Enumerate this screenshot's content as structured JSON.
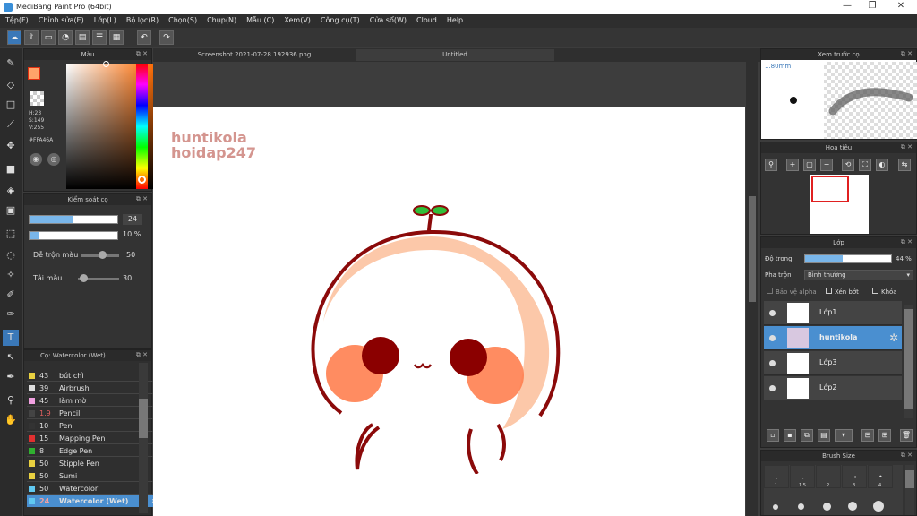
{
  "window": {
    "title": "MediBang Paint Pro (64bit)",
    "min": "—",
    "max": "❐",
    "close": "✕"
  },
  "menu": [
    "Tệp(F)",
    "Chỉnh sửa(E)",
    "Lớp(L)",
    "Bộ lọc(R)",
    "Chọn(S)",
    "Chụp(N)",
    "Mẫu (C)",
    "Xem(V)",
    "Công cụ(T)",
    "Cửa sổ(W)",
    "Cloud",
    "Help"
  ],
  "color_panel": {
    "title": "Màu",
    "h": "H:23",
    "s": "S:149",
    "v": "V:255",
    "hex": "#FFA46A",
    "fg": "#FFA46A"
  },
  "brush_control": {
    "title": "Kiểm soát cọ",
    "size_value": "24",
    "opacity_value": "10 %",
    "blend_label": "Dễ trộn màu",
    "blend_value": "50",
    "flow_label": "Tải màu",
    "flow_value": "30"
  },
  "brush_panel": {
    "title": "Cọ: Watercolor (Wet)",
    "items": [
      {
        "size": "43",
        "name": "bút chì",
        "color": "#e8d040"
      },
      {
        "size": "39",
        "name": "Airbrush",
        "color": "#dddddd"
      },
      {
        "size": "45",
        "name": "làm mờ",
        "color": "#f0a0e0"
      },
      {
        "size": "1.9",
        "name": "Pencil",
        "color": "#444444"
      },
      {
        "size": "10",
        "name": "Pen",
        "color": "#333333"
      },
      {
        "size": "15",
        "name": "Mapping Pen",
        "color": "#e03030"
      },
      {
        "size": "8",
        "name": "Edge Pen",
        "color": "#30b030"
      },
      {
        "size": "50",
        "name": "Stipple Pen",
        "color": "#e8d040"
      },
      {
        "size": "50",
        "name": "Sumi",
        "color": "#e8d040"
      },
      {
        "size": "50",
        "name": "Watercolor",
        "color": "#60c8f0"
      },
      {
        "size": "24",
        "name": "Watercolor (Wet)",
        "color": "#60c8f0"
      }
    ]
  },
  "tabs": [
    "Screenshot 2021-07-28 192936.png",
    "Untitled"
  ],
  "canvas_text": {
    "line1": "huntikola",
    "line2": "hoidap247"
  },
  "preview_panel": {
    "title": "Xem trước cọ",
    "size": "1.80mm"
  },
  "navigator_panel": {
    "title": "Hoa tiêu"
  },
  "layer_panel": {
    "title": "Lớp",
    "opacity_label": "Độ trong",
    "opacity_value": "44 %",
    "opacity_frac": 0.44,
    "blend_label": "Pha trộn",
    "blend_value": "Bình thường",
    "protect_alpha": "Bảo vệ alpha",
    "clipping": "Xén bớt",
    "lock": "Khóa",
    "layers": [
      {
        "name": "Lớp1",
        "selected": false
      },
      {
        "name": "huntikola",
        "selected": true
      },
      {
        "name": "Lớp3",
        "selected": false
      },
      {
        "name": "Lớp2",
        "selected": false
      }
    ]
  },
  "brush_size_panel": {
    "title": "Brush Size",
    "sizes": [
      "1",
      "1.5",
      "2",
      "3",
      "4"
    ]
  }
}
